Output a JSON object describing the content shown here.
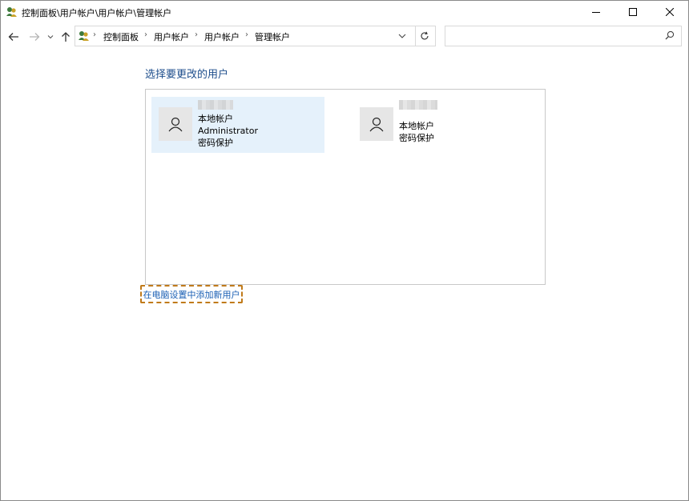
{
  "window": {
    "title": "控制面板\\用户帐户\\用户帐户\\管理帐户",
    "app_icon": "users-control-panel-icon",
    "controls": {
      "minimize": "minimize-icon",
      "maximize": "maximize-icon",
      "close": "close-icon"
    }
  },
  "navigation": {
    "back": "back-arrow-icon",
    "forward": "forward-arrow-icon",
    "recent": "chevron-down-icon",
    "up": "up-arrow-icon",
    "breadcrumbs": [
      "控制面板",
      "用户帐户",
      "用户帐户",
      "管理帐户"
    ],
    "refresh": "refresh-icon",
    "search": {
      "value": "",
      "placeholder": "",
      "icon": "search-icon"
    }
  },
  "main": {
    "heading": "选择要更改的用户",
    "users": [
      {
        "name": "",
        "lines": [
          "本地帐户",
          "Administrator",
          "密码保护"
        ],
        "selected": true
      },
      {
        "name": "",
        "lines": [
          "本地帐户",
          "密码保护"
        ],
        "selected": false
      }
    ],
    "add_user_link": "在电脑设置中添加新用户"
  },
  "colors": {
    "heading": "#1e4e8c",
    "link": "#1a5fb4",
    "selected_tile": "#e5f1fb",
    "highlight_border": "#c07a1a"
  }
}
